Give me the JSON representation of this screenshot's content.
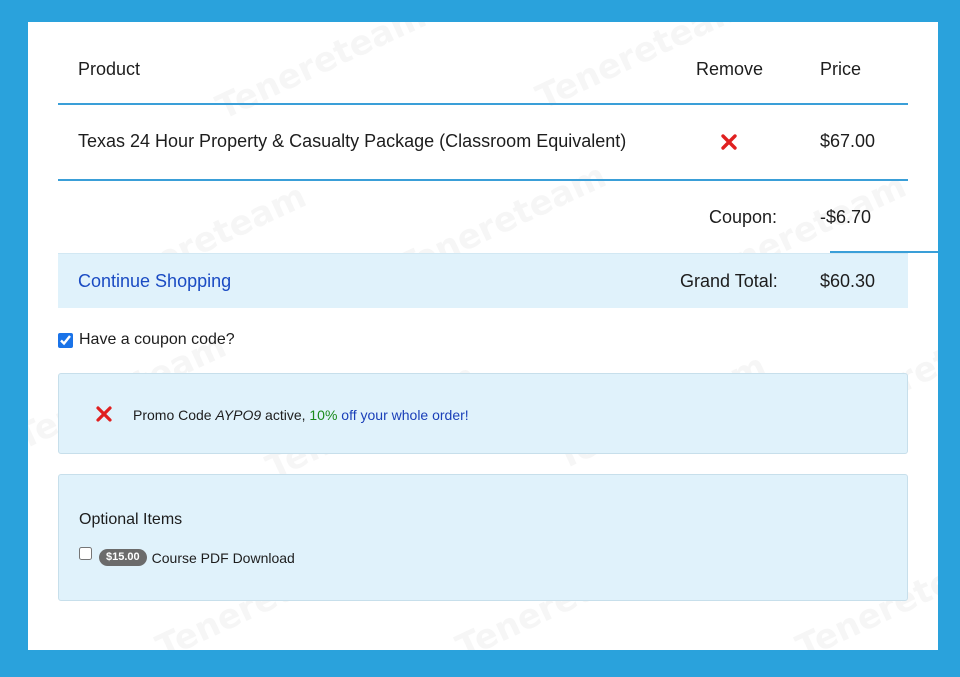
{
  "table": {
    "headers": {
      "product": "Product",
      "remove": "Remove",
      "price": "Price"
    },
    "rows": [
      {
        "product": "Texas 24 Hour Property & Casualty Package (Classroom Equivalent)",
        "price": "$67.00",
        "remove_icon": "close-x-icon"
      }
    ]
  },
  "summary": {
    "coupon_label": "Coupon:",
    "coupon_value": "-$6.70",
    "grand_total_label": "Grand Total:",
    "grand_total_value": "$60.30",
    "continue_shopping": "Continue Shopping"
  },
  "coupon_checkbox": {
    "label": "Have a coupon code?",
    "checked": true
  },
  "promo": {
    "prefix": "Promo Code ",
    "code": "AYPO9",
    "mid": " active, ",
    "discount": "10%",
    "suffix": " off your whole order!",
    "icon": "close-x-icon"
  },
  "optional_items": {
    "title": "Optional Items",
    "items": [
      {
        "price_badge": "$15.00",
        "label": "Course PDF Download",
        "checked": false
      }
    ]
  },
  "colors": {
    "page_background": "#2aa2dc",
    "accent_line": "#3a9fd8",
    "panel": "#e0f2fb",
    "link": "#1a4bc3",
    "remove_red": "#e02020",
    "discount_green": "#1a8a1a"
  }
}
